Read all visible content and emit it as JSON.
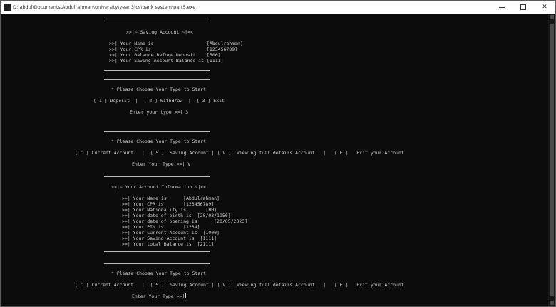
{
  "window": {
    "title": "D:\\abdul\\Documents\\Abdulrahman\\university\\year 3\\cs\\bank system\\part5.exe",
    "minimize_icon": "minimize-icon",
    "maximize_icon": "maximize-icon",
    "close_icon": "close-icon",
    "close_glyph": "✕"
  },
  "saving_section": {
    "header": ">>|~ Saving Account ~|<<",
    "name_label": ">>| Your Name is",
    "name_value": "[Abdulrahman]",
    "cpr_label": ">>| Your CPR is",
    "cpr_value": "[123456789]",
    "balance_before_label": ">>| Your Balance Before Deposit",
    "balance_before_value": "[500]",
    "saving_balance_label": ">>| Your Saving Account Balance is",
    "saving_balance_value": "[1111]"
  },
  "menu1": {
    "prompt": "* Please Choose Your Type to Start",
    "options": "[ 1 ] Deposit  |  [ 2 ] Withdraw  |  [ 3 ] Exit",
    "input_line": "Enter your type >>| 3"
  },
  "menu2": {
    "prompt": "* Please Choose Your Type to Start",
    "options": "[ C ] Current Account   |  [ S ]  Saving Account | [ V ]  Viewing full details Account   |   [ E ]   Exit your Account",
    "input_line": "Enter Your Type >>| V"
  },
  "info_section": {
    "header": ">>|~ Your Account Information ~|<<",
    "lines": [
      ">>| Your Name is      [Abdulrahman]",
      ">>| Your CPR is       [123456789]",
      ">>| Your Nationality is       [BH]",
      ">>| Your date of birth is  [20/03/1950]",
      ">>| Your date of opening is      [20/05/2023]",
      ">>| Your PIN is       [1234]",
      ">>| Your Current Account is  [1000]",
      ">>| Your Saving Account is  [1111]",
      ">>| Your total Balance is  [2111]"
    ]
  },
  "menu3": {
    "prompt": "* Please Choose Your Type to Start",
    "options": "[ C ] Current Account   |  [ S ]  Saving Account | [ V ]  Viewing full details Account   |   [ E ]   Exit your Account",
    "input_line": "Enter Your Type >>|"
  }
}
